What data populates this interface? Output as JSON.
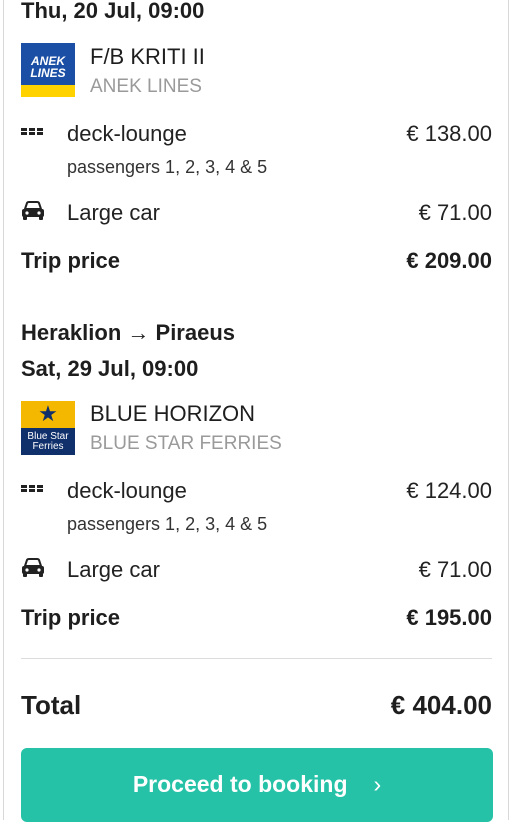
{
  "trip1": {
    "date": "Thu, 20 Jul, 09:00",
    "vessel": "F/B KRITI II",
    "company": "ANEK LINES",
    "logo_text_1": "ANEK",
    "logo_text_2": "LINES",
    "seat_icon": "seat-icon",
    "seat_label": "deck-lounge",
    "seat_price": "€ 138.00",
    "passengers": "passengers 1, 2, 3, 4 & 5",
    "car_icon": "car-icon",
    "car_label": "Large car",
    "car_price": "€ 71.00",
    "trip_price_label": "Trip price",
    "trip_price": "€ 209.00"
  },
  "trip2": {
    "route_from": "Heraklion",
    "route_arrow": "→",
    "route_to": "Piraeus",
    "date": "Sat, 29 Jul, 09:00",
    "vessel": "BLUE HORIZON",
    "company": "BLUE STAR FERRIES",
    "logo_text_1": "Blue Star",
    "logo_text_2": "Ferries",
    "seat_icon": "seat-icon",
    "seat_label": "deck-lounge",
    "seat_price": "€ 124.00",
    "passengers": "passengers 1, 2, 3, 4 & 5",
    "car_icon": "car-icon",
    "car_label": "Large car",
    "car_price": "€ 71.00",
    "trip_price_label": "Trip price",
    "trip_price": "€ 195.00"
  },
  "total": {
    "label": "Total",
    "price": "€ 404.00"
  },
  "cta": {
    "label": "Proceed to booking",
    "chevron": "›"
  },
  "colors": {
    "accent": "#26c2a7",
    "anek_blue": "#1b4fa5",
    "anek_yellow": "#ffd200",
    "bluestar_navy": "#10306b",
    "bluestar_yellow": "#f5b800"
  }
}
